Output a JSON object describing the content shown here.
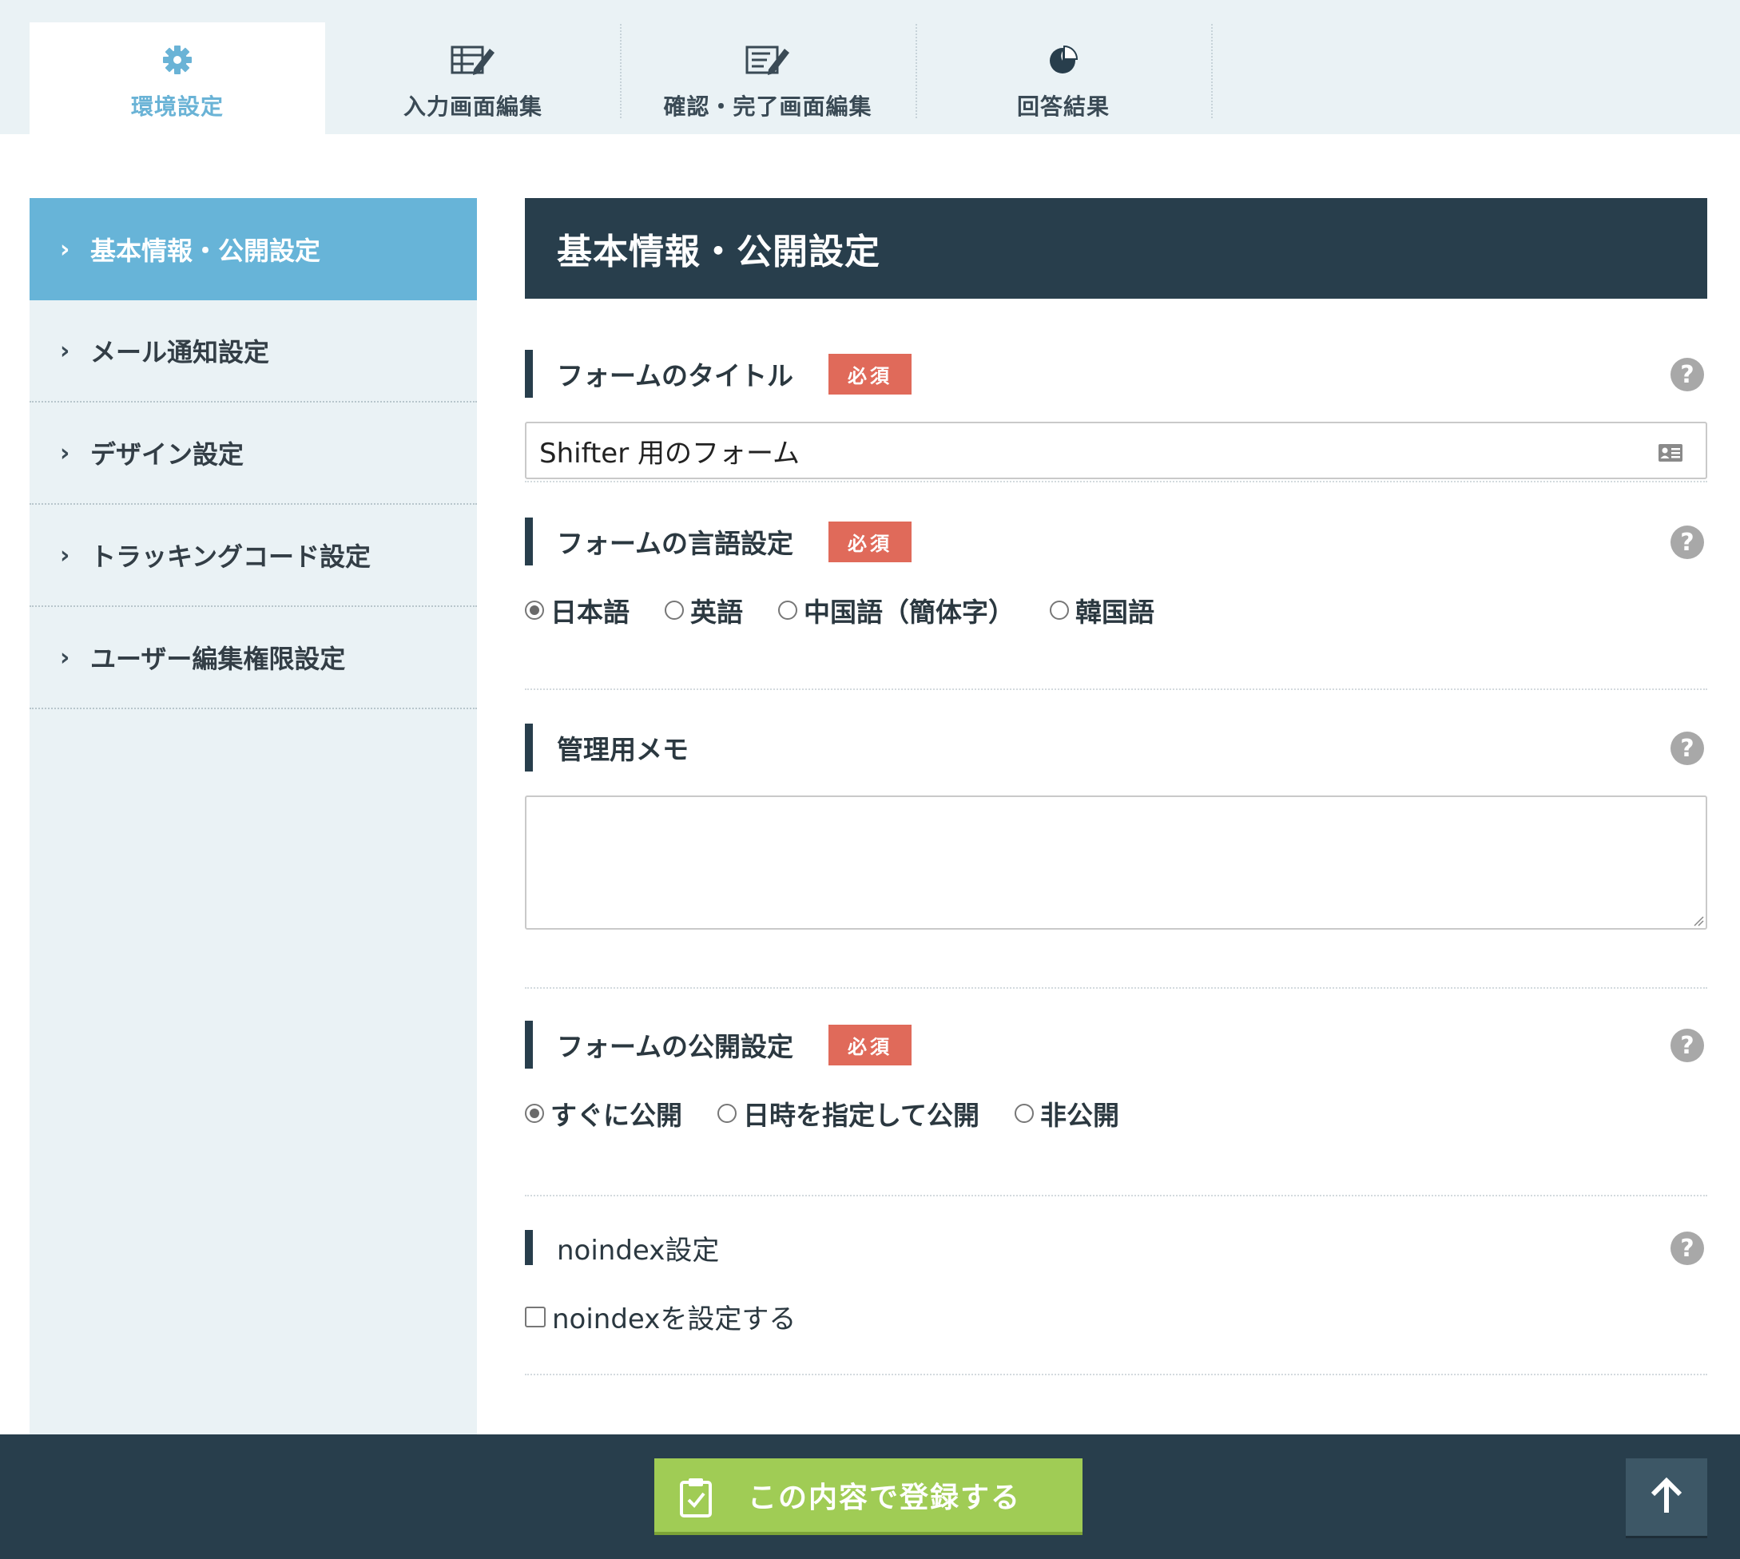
{
  "tabs": [
    {
      "label": "環境設定",
      "icon": "gear-icon",
      "active": true
    },
    {
      "label": "入力画面編集",
      "icon": "table-edit-icon",
      "active": false
    },
    {
      "label": "確認・完了画面編集",
      "icon": "document-edit-icon",
      "active": false
    },
    {
      "label": "回答結果",
      "icon": "pie-chart-icon",
      "active": false
    }
  ],
  "sidebar": {
    "items": [
      {
        "label": "基本情報・公開設定",
        "active": true
      },
      {
        "label": "メール通知設定",
        "active": false
      },
      {
        "label": "デザイン設定",
        "active": false
      },
      {
        "label": "トラッキングコード設定",
        "active": false
      },
      {
        "label": "ユーザー編集権限設定",
        "active": false
      }
    ]
  },
  "main": {
    "page_title": "基本情報・公開設定",
    "required_label": "必須",
    "form_title": {
      "label": "フォームのタイトル",
      "value": "Shifter 用のフォーム"
    },
    "language": {
      "label": "フォームの言語設定",
      "options": [
        "日本語",
        "英語",
        "中国語（簡体字）",
        "韓国語"
      ],
      "selected": "日本語"
    },
    "memo": {
      "label": "管理用メモ",
      "value": ""
    },
    "publish": {
      "label": "フォームの公開設定",
      "options": [
        "すぐに公開",
        "日時を指定して公開",
        "非公開"
      ],
      "selected": "すぐに公開"
    },
    "noindex": {
      "label": "noindex設定",
      "checkbox_label": "noindexを設定する",
      "checked": false
    }
  },
  "footer": {
    "submit_label": "この内容で登録する"
  },
  "colors": {
    "accent": "#67b4d8",
    "header_dark": "#283e4c",
    "required_badge": "#e06a5a",
    "submit_green": "#a0cc55",
    "sidebar_bg": "#eaf2f5"
  }
}
